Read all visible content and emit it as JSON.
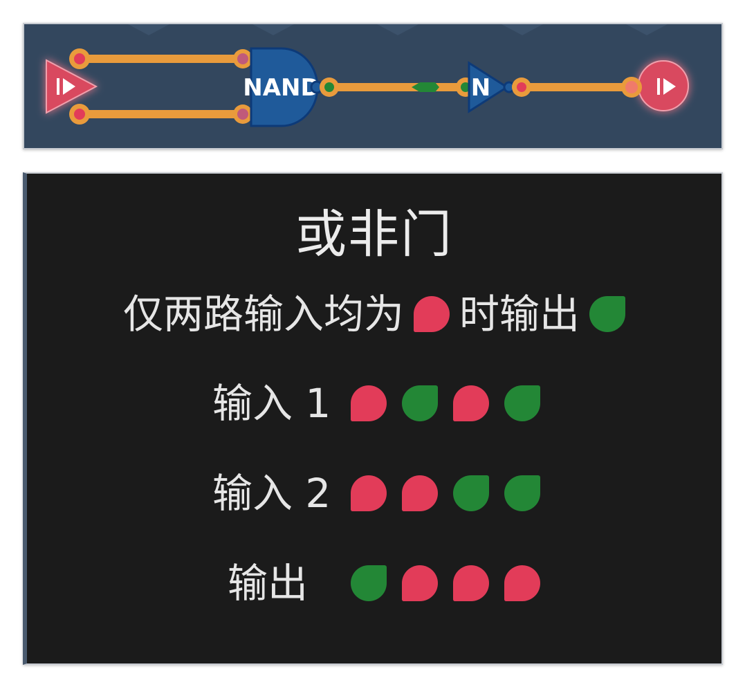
{
  "circuit": {
    "gate1_label": "NAND",
    "gate2_label": "N",
    "colors": {
      "background": "#33475e",
      "wire": "#e99b3c",
      "gate": "#1f5a9a",
      "red_signal": "#e23c59",
      "green_signal": "#238736"
    }
  },
  "description": {
    "title": "或非门",
    "rule": {
      "prefix": "仅两路输入均为",
      "input_signal": "red",
      "middle": "时输出",
      "output_signal": "green"
    },
    "truth_table": [
      {
        "label": "输入 1",
        "signals": [
          "red",
          "green",
          "red",
          "green"
        ]
      },
      {
        "label": "输入 2",
        "signals": [
          "red",
          "red",
          "green",
          "green"
        ]
      },
      {
        "label": "输出",
        "signals": [
          "green",
          "red",
          "red",
          "red"
        ]
      }
    ]
  }
}
